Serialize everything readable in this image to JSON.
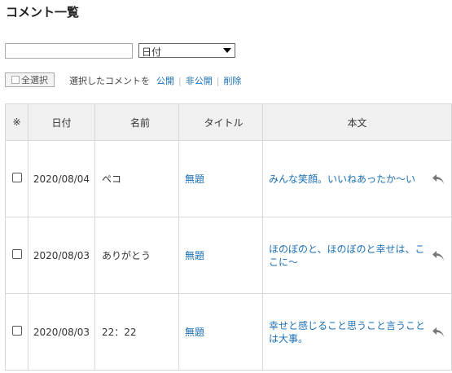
{
  "page_title": "コメント一覧",
  "search": {
    "value": "",
    "placeholder": ""
  },
  "sort_select": {
    "selected": "日付"
  },
  "toolbar": {
    "select_all_label": "全選択",
    "selected_action_label": "選択したコメントを",
    "publish_label": "公開",
    "unpublish_label": "非公開",
    "delete_label": "削除",
    "separator": "|"
  },
  "table": {
    "headers": {
      "mark": "※",
      "date": "日付",
      "name": "名前",
      "title": "タイトル",
      "body": "本文"
    },
    "rows": [
      {
        "date": "2020/08/04",
        "name": "ペコ",
        "title": "無題",
        "body": "みんな笑顔。いいねあったか〜い"
      },
      {
        "date": "2020/08/03",
        "name": "ありがとう",
        "title": "無題",
        "body": "ほのぼのと、ほのぼのと幸せは、ここに〜"
      },
      {
        "date": "2020/08/03",
        "name": "22：22",
        "title": "無題",
        "body": "幸せと感じること思うこと言うことは大事。"
      }
    ]
  },
  "icons": {
    "reply": "reply-arrow-icon"
  },
  "colors": {
    "link": "#1a6fb5",
    "header_bg": "#f0f0f0",
    "border": "#d8d8d8"
  }
}
